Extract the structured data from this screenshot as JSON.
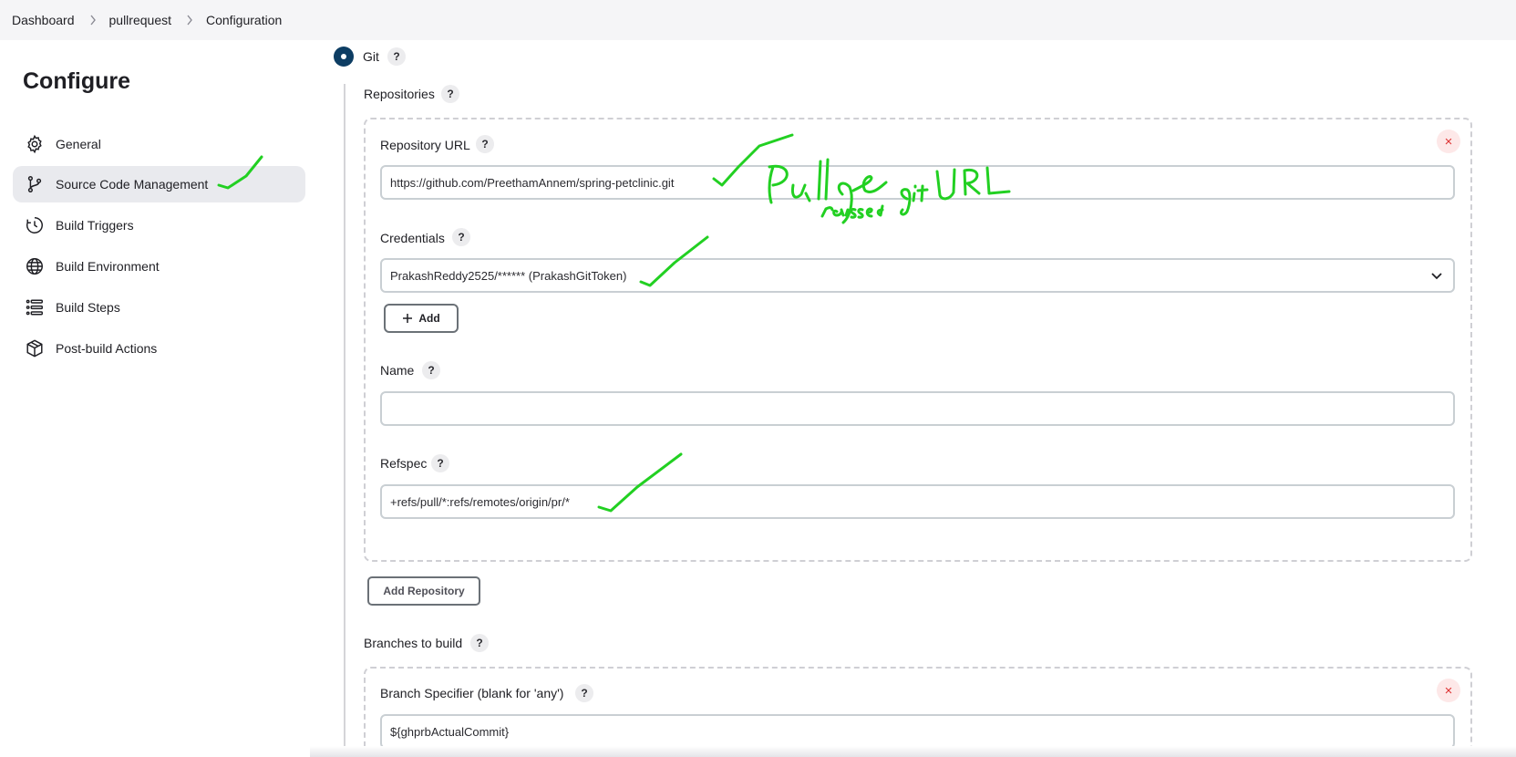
{
  "breadcrumb": [
    "Dashboard",
    "pullrequest",
    "Configuration"
  ],
  "sidebar": {
    "title": "Configure",
    "items": [
      {
        "label": "General",
        "icon": "gear-icon"
      },
      {
        "label": "Source Code Management",
        "icon": "branch-icon",
        "active": true
      },
      {
        "label": "Build Triggers",
        "icon": "clock-icon"
      },
      {
        "label": "Build Environment",
        "icon": "globe-icon"
      },
      {
        "label": "Build Steps",
        "icon": "list-icon"
      },
      {
        "label": "Post-build Actions",
        "icon": "package-icon"
      }
    ]
  },
  "scm": {
    "option_label": "Git",
    "repositories_label": "Repositories",
    "repo_url_label": "Repository URL",
    "repo_url_value": "https://github.com/PreethamAnnem/spring-petclinic.git",
    "credentials_label": "Credentials",
    "credentials_value": "PrakashReddy2525/****** (PrakashGitToken)",
    "add_label": "Add",
    "name_label": "Name",
    "name_value": "",
    "refspec_label": "Refspec",
    "refspec_value": "+refs/pull/*:refs/remotes/origin/pr/*",
    "add_repository_label": "Add Repository",
    "branches_label": "Branches to build",
    "branch_specifier_label": "Branch Specifier (blank for 'any')",
    "branch_specifier_value": "${ghprbActualCommit}"
  },
  "help_text": "?",
  "close_text": "×",
  "annotation_color": "#22d022"
}
